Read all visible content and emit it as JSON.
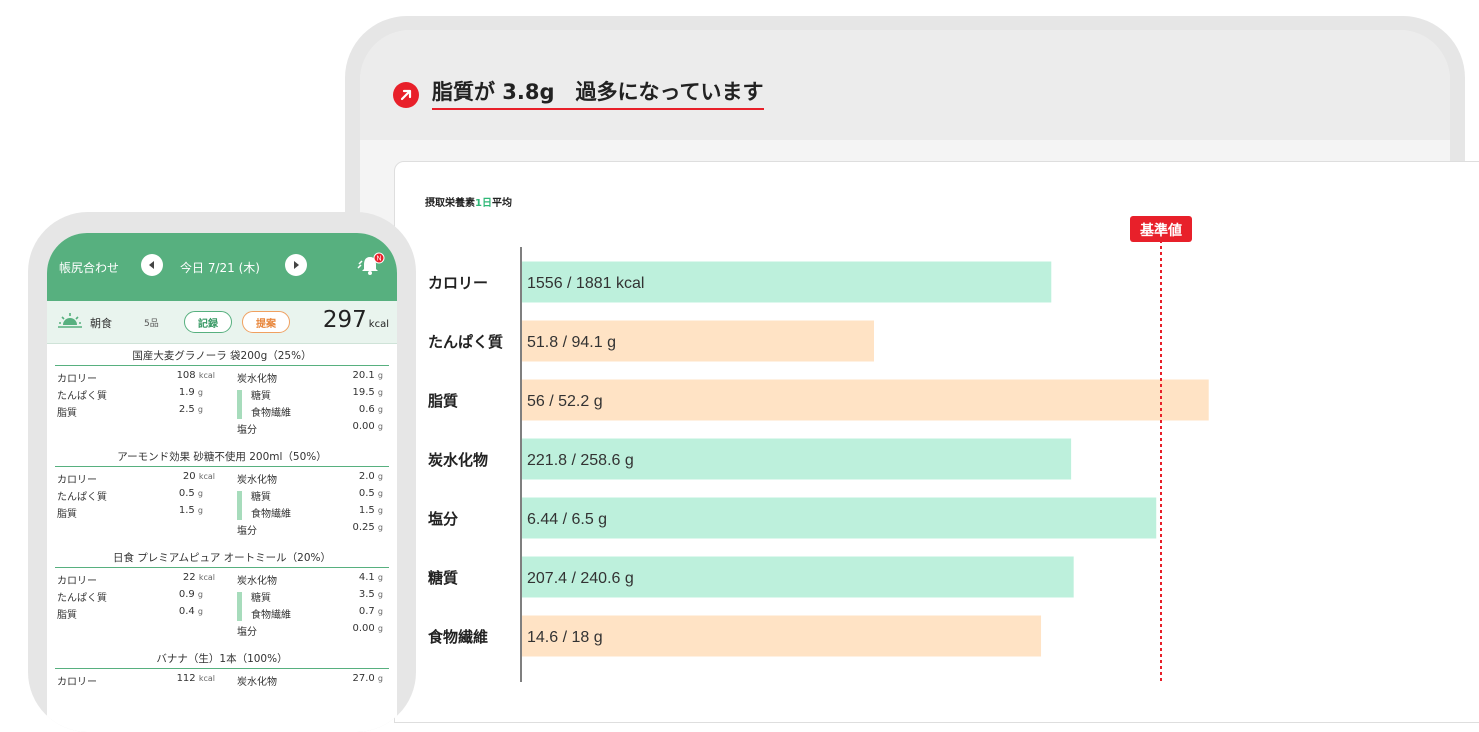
{
  "tablet": {
    "alert_text": "脂質が 3.8g　過多になっています",
    "caption_prefix": "摂取栄養素",
    "caption_highlight": "1日",
    "caption_suffix": "平均",
    "chart_data": {
      "type": "bar",
      "orientation": "horizontal",
      "title": "",
      "reference_label": "基準値",
      "categories": [
        "カロリー",
        "たんぱく質",
        "脂質",
        "炭水化物",
        "塩分",
        "糖質",
        "食物繊維"
      ],
      "intake": [
        1556,
        51.8,
        56,
        221.8,
        6.44,
        207.4,
        14.6
      ],
      "standard": [
        1881,
        94.1,
        52.2,
        258.6,
        6.5,
        240.6,
        18
      ],
      "percent_of_standard": [
        82.7,
        55.0,
        107.3,
        85.8,
        99.1,
        86.2,
        81.1
      ],
      "value_labels": [
        "1556 / 1881 kcal",
        "51.8 / 94.1 g",
        "56 / 52.2 g",
        "221.8 / 258.6 g",
        "6.44 / 6.5 g",
        "207.4 / 240.6 g",
        "14.6 / 18 g"
      ],
      "bar_colors": [
        "#bdf0dc",
        "#ffe3c5",
        "#ffe3c5",
        "#bdf0dc",
        "#bdf0dc",
        "#bdf0dc",
        "#ffe3c5"
      ],
      "reference_color": "#e8202a"
    }
  },
  "phone": {
    "header_title": "帳尻合わせ",
    "date_label": "今日 7/21 (木)",
    "header_color": "#57b07f",
    "meal_name": "朝食",
    "meal_count": "5品",
    "record_label": "記録",
    "suggest_label": "提案",
    "meal_kcal": "297",
    "kcal_unit": "kcal",
    "foods": [
      {
        "title": "国産大麦グラノーラ 袋200g（25%）",
        "cal_label": "カロリー",
        "cal": "108",
        "cal_unit": "kcal",
        "protein_label": "たんぱく質",
        "protein": "1.9",
        "fat_label": "脂質",
        "fat": "2.5",
        "carb_label": "炭水化物",
        "carb": "20.1",
        "sugar_label": "糖質",
        "sugar": "19.5",
        "fiber_label": "食物繊維",
        "fiber": "0.6",
        "salt_label": "塩分",
        "salt": "0.00",
        "unit": "g"
      },
      {
        "title": "アーモンド効果 砂糖不使用 200ml（50%）",
        "cal_label": "カロリー",
        "cal": "20",
        "cal_unit": "kcal",
        "protein_label": "たんぱく質",
        "protein": "0.5",
        "fat_label": "脂質",
        "fat": "1.5",
        "carb_label": "炭水化物",
        "carb": "2.0",
        "sugar_label": "糖質",
        "sugar": "0.5",
        "fiber_label": "食物繊維",
        "fiber": "1.5",
        "salt_label": "塩分",
        "salt": "0.25",
        "unit": "g"
      },
      {
        "title": "日食 プレミアムピュア オートミール（20%）",
        "cal_label": "カロリー",
        "cal": "22",
        "cal_unit": "kcal",
        "protein_label": "たんぱく質",
        "protein": "0.9",
        "fat_label": "脂質",
        "fat": "0.4",
        "carb_label": "炭水化物",
        "carb": "4.1",
        "sugar_label": "糖質",
        "sugar": "3.5",
        "fiber_label": "食物繊維",
        "fiber": "0.7",
        "salt_label": "塩分",
        "salt": "0.00",
        "unit": "g"
      },
      {
        "title": "バナナ（生）1本（100%）",
        "cal_label": "カロリー",
        "cal": "112",
        "cal_unit": "kcal",
        "protein_label": "たんぱく質",
        "protein": "",
        "fat_label": "脂質",
        "fat": "",
        "carb_label": "炭水化物",
        "carb": "27.0",
        "sugar_label": "糖質",
        "sugar": "",
        "fiber_label": "食物繊維",
        "fiber": "",
        "salt_label": "塩分",
        "salt": "",
        "unit": "g"
      }
    ]
  }
}
